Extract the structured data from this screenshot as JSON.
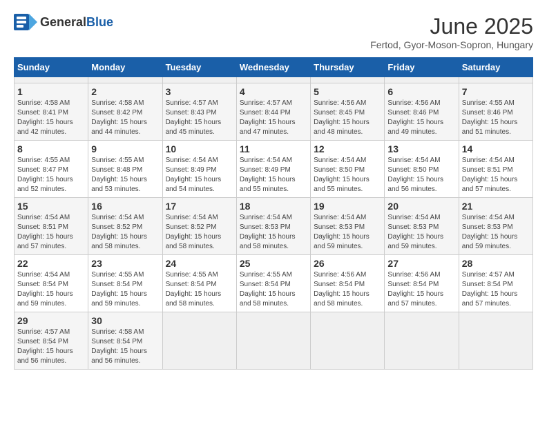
{
  "header": {
    "logo_general": "General",
    "logo_blue": "Blue",
    "title": "June 2025",
    "subtitle": "Fertod, Gyor-Moson-Sopron, Hungary"
  },
  "calendar": {
    "days_of_week": [
      "Sunday",
      "Monday",
      "Tuesday",
      "Wednesday",
      "Thursday",
      "Friday",
      "Saturday"
    ],
    "weeks": [
      [
        {
          "day": "",
          "empty": true
        },
        {
          "day": "",
          "empty": true
        },
        {
          "day": "",
          "empty": true
        },
        {
          "day": "",
          "empty": true
        },
        {
          "day": "",
          "empty": true
        },
        {
          "day": "",
          "empty": true
        },
        {
          "day": "",
          "empty": true
        }
      ],
      [
        {
          "day": "1",
          "sunrise": "4:58 AM",
          "sunset": "8:41 PM",
          "daylight": "15 hours and 42 minutes."
        },
        {
          "day": "2",
          "sunrise": "4:58 AM",
          "sunset": "8:42 PM",
          "daylight": "15 hours and 44 minutes."
        },
        {
          "day": "3",
          "sunrise": "4:57 AM",
          "sunset": "8:43 PM",
          "daylight": "15 hours and 45 minutes."
        },
        {
          "day": "4",
          "sunrise": "4:57 AM",
          "sunset": "8:44 PM",
          "daylight": "15 hours and 47 minutes."
        },
        {
          "day": "5",
          "sunrise": "4:56 AM",
          "sunset": "8:45 PM",
          "daylight": "15 hours and 48 minutes."
        },
        {
          "day": "6",
          "sunrise": "4:56 AM",
          "sunset": "8:46 PM",
          "daylight": "15 hours and 49 minutes."
        },
        {
          "day": "7",
          "sunrise": "4:55 AM",
          "sunset": "8:46 PM",
          "daylight": "15 hours and 51 minutes."
        }
      ],
      [
        {
          "day": "8",
          "sunrise": "4:55 AM",
          "sunset": "8:47 PM",
          "daylight": "15 hours and 52 minutes."
        },
        {
          "day": "9",
          "sunrise": "4:55 AM",
          "sunset": "8:48 PM",
          "daylight": "15 hours and 53 minutes."
        },
        {
          "day": "10",
          "sunrise": "4:54 AM",
          "sunset": "8:49 PM",
          "daylight": "15 hours and 54 minutes."
        },
        {
          "day": "11",
          "sunrise": "4:54 AM",
          "sunset": "8:49 PM",
          "daylight": "15 hours and 55 minutes."
        },
        {
          "day": "12",
          "sunrise": "4:54 AM",
          "sunset": "8:50 PM",
          "daylight": "15 hours and 55 minutes."
        },
        {
          "day": "13",
          "sunrise": "4:54 AM",
          "sunset": "8:50 PM",
          "daylight": "15 hours and 56 minutes."
        },
        {
          "day": "14",
          "sunrise": "4:54 AM",
          "sunset": "8:51 PM",
          "daylight": "15 hours and 57 minutes."
        }
      ],
      [
        {
          "day": "15",
          "sunrise": "4:54 AM",
          "sunset": "8:51 PM",
          "daylight": "15 hours and 57 minutes."
        },
        {
          "day": "16",
          "sunrise": "4:54 AM",
          "sunset": "8:52 PM",
          "daylight": "15 hours and 58 minutes."
        },
        {
          "day": "17",
          "sunrise": "4:54 AM",
          "sunset": "8:52 PM",
          "daylight": "15 hours and 58 minutes."
        },
        {
          "day": "18",
          "sunrise": "4:54 AM",
          "sunset": "8:53 PM",
          "daylight": "15 hours and 58 minutes."
        },
        {
          "day": "19",
          "sunrise": "4:54 AM",
          "sunset": "8:53 PM",
          "daylight": "15 hours and 59 minutes."
        },
        {
          "day": "20",
          "sunrise": "4:54 AM",
          "sunset": "8:53 PM",
          "daylight": "15 hours and 59 minutes."
        },
        {
          "day": "21",
          "sunrise": "4:54 AM",
          "sunset": "8:53 PM",
          "daylight": "15 hours and 59 minutes."
        }
      ],
      [
        {
          "day": "22",
          "sunrise": "4:54 AM",
          "sunset": "8:54 PM",
          "daylight": "15 hours and 59 minutes."
        },
        {
          "day": "23",
          "sunrise": "4:55 AM",
          "sunset": "8:54 PM",
          "daylight": "15 hours and 59 minutes."
        },
        {
          "day": "24",
          "sunrise": "4:55 AM",
          "sunset": "8:54 PM",
          "daylight": "15 hours and 58 minutes."
        },
        {
          "day": "25",
          "sunrise": "4:55 AM",
          "sunset": "8:54 PM",
          "daylight": "15 hours and 58 minutes."
        },
        {
          "day": "26",
          "sunrise": "4:56 AM",
          "sunset": "8:54 PM",
          "daylight": "15 hours and 58 minutes."
        },
        {
          "day": "27",
          "sunrise": "4:56 AM",
          "sunset": "8:54 PM",
          "daylight": "15 hours and 57 minutes."
        },
        {
          "day": "28",
          "sunrise": "4:57 AM",
          "sunset": "8:54 PM",
          "daylight": "15 hours and 57 minutes."
        }
      ],
      [
        {
          "day": "29",
          "sunrise": "4:57 AM",
          "sunset": "8:54 PM",
          "daylight": "15 hours and 56 minutes."
        },
        {
          "day": "30",
          "sunrise": "4:58 AM",
          "sunset": "8:54 PM",
          "daylight": "15 hours and 56 minutes."
        },
        {
          "day": "",
          "empty": true
        },
        {
          "day": "",
          "empty": true
        },
        {
          "day": "",
          "empty": true
        },
        {
          "day": "",
          "empty": true
        },
        {
          "day": "",
          "empty": true
        }
      ]
    ]
  }
}
